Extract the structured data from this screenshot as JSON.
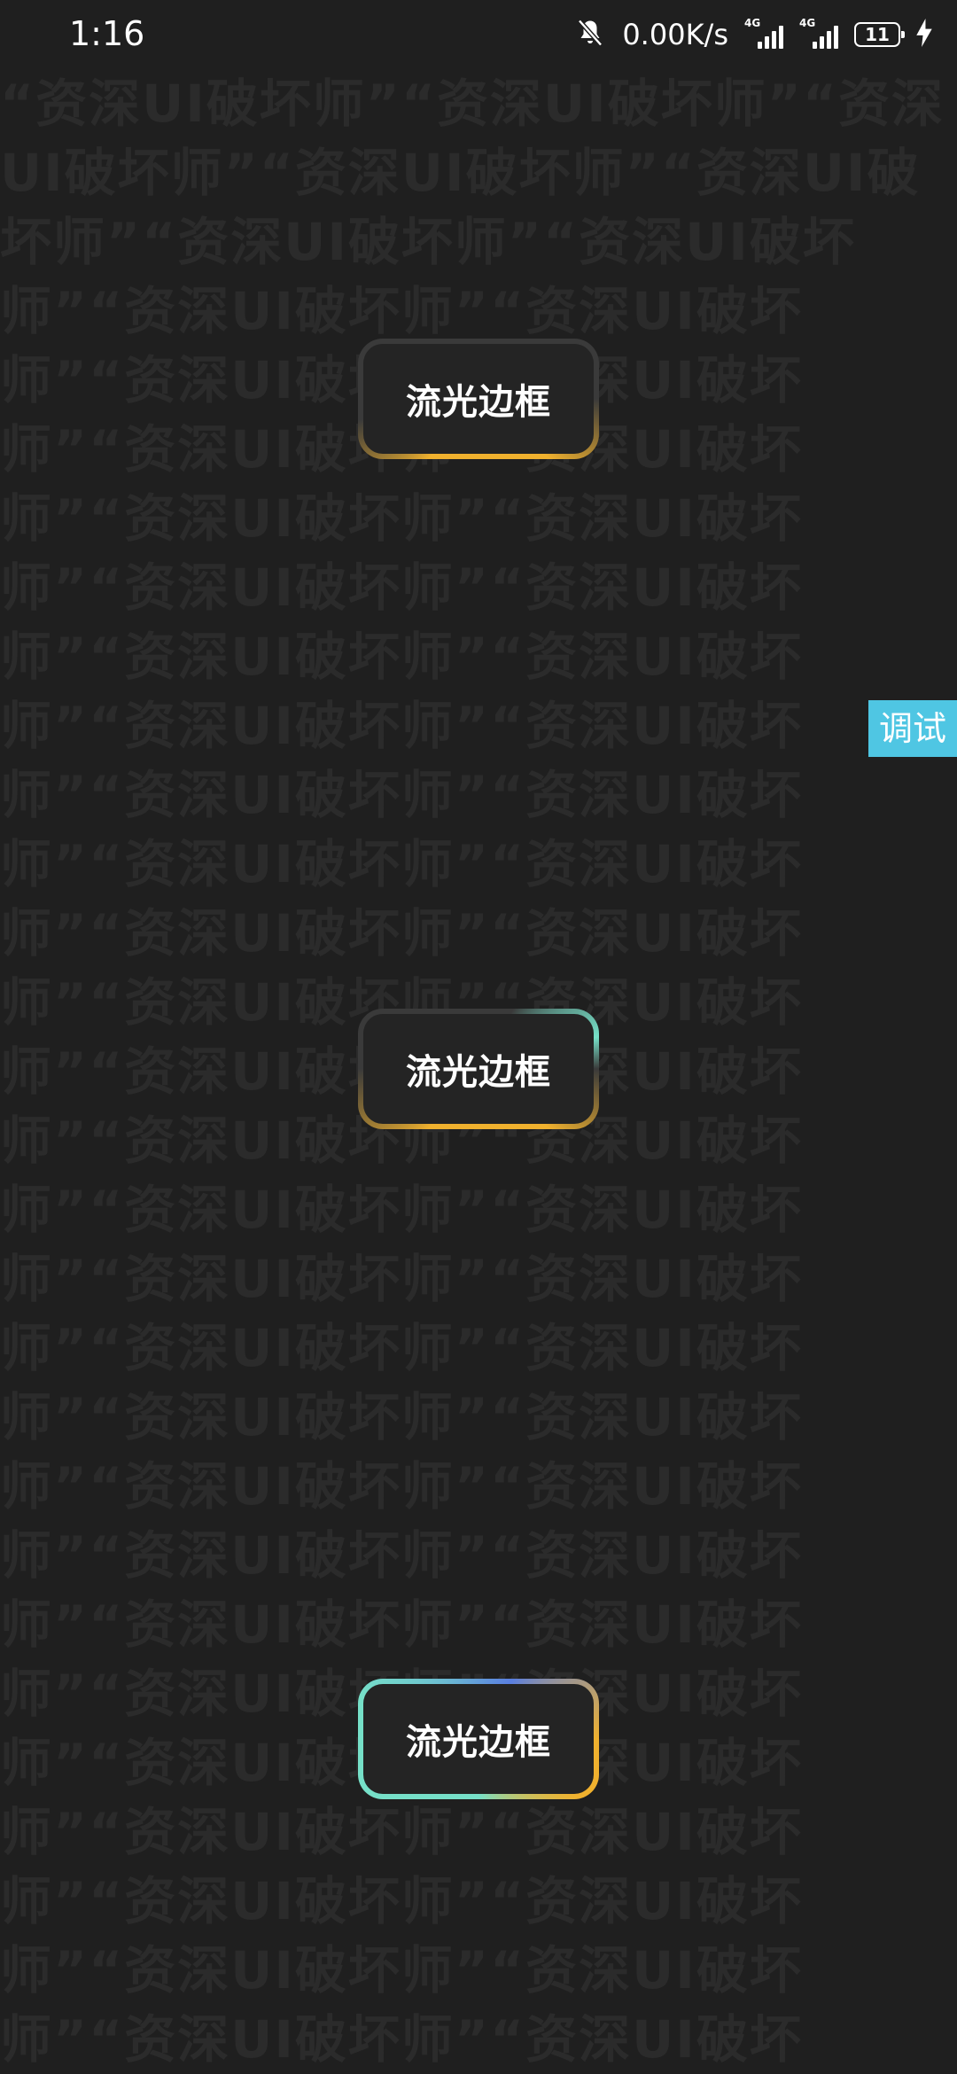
{
  "status_bar": {
    "time": "1:16",
    "network_speed": "0.00K/s",
    "signal_1_label": "4G",
    "signal_2_label": "4G",
    "battery_level": "11",
    "icons": [
      "bell-muted-icon",
      "signal-icon",
      "signal-icon",
      "battery-icon",
      "charging-bolt-icon"
    ]
  },
  "watermark": {
    "text": "“资深UI破坏师”"
  },
  "buttons": [
    {
      "label": "流光边框"
    },
    {
      "label": "流光边框"
    },
    {
      "label": "流光边框"
    }
  ],
  "debug_tab": {
    "label": "调试"
  },
  "colors": {
    "background": "#1f1f1f",
    "gold": "#f0b12e",
    "teal": "#76e0c8",
    "blue": "#5a7fe0",
    "debug_tab": "#4fc6e3"
  }
}
